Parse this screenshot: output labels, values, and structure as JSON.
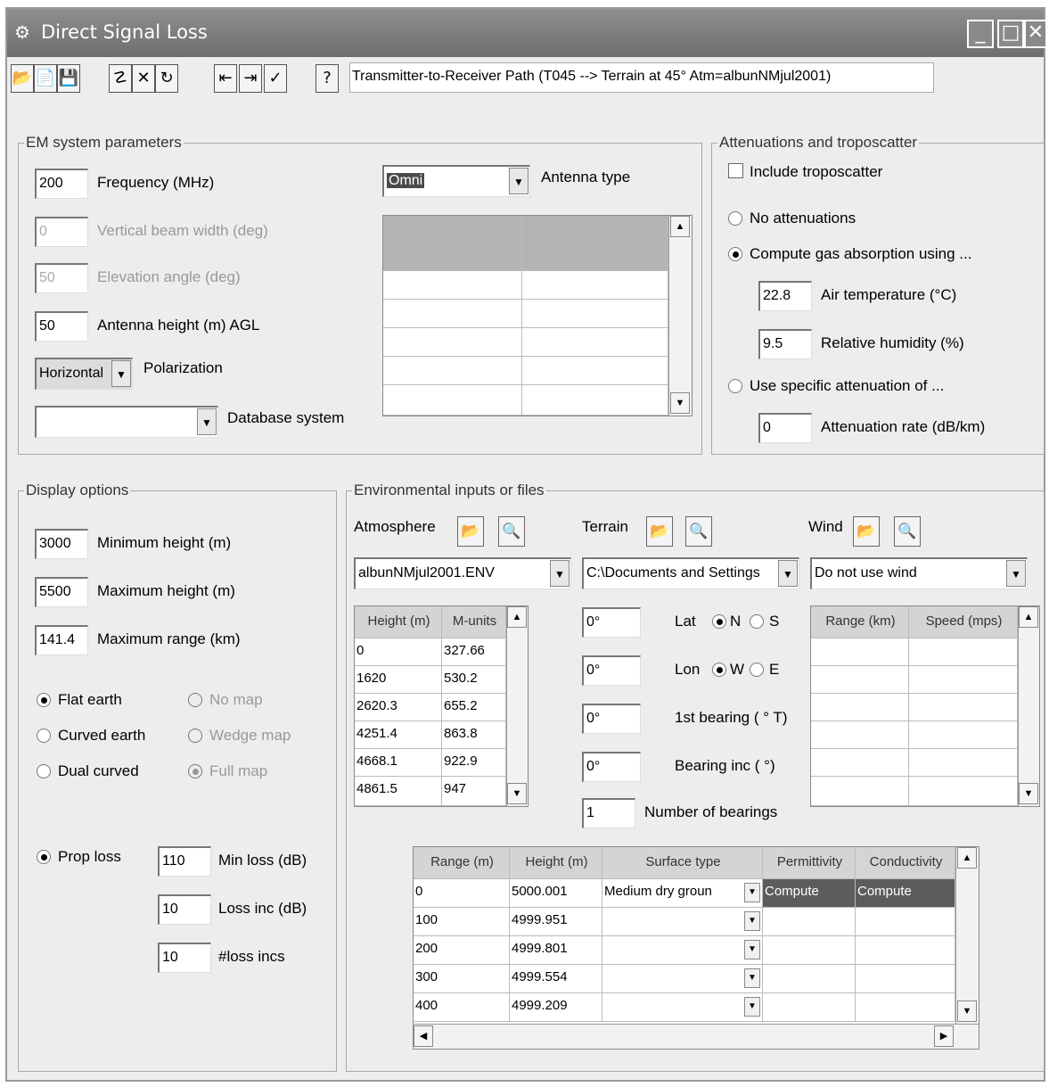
{
  "window": {
    "title": "Direct Signal Loss"
  },
  "toolbar": {
    "path": "Transmitter-to-Receiver Path (T045 --> Terrain at 45°  Atm=albunNMjul2001)"
  },
  "em": {
    "legend": "EM system parameters",
    "frequency": {
      "value": "200",
      "label": "Frequency (MHz)"
    },
    "beam": {
      "value": "0",
      "label": "Vertical beam width (deg)"
    },
    "elevation": {
      "value": "50",
      "label": "Elevation angle (deg)"
    },
    "height": {
      "value": "50",
      "label": "Antenna height (m)  AGL"
    },
    "polarization": {
      "value": "Horizontal",
      "label": "Polarization"
    },
    "database": {
      "value": "",
      "label": "Database system"
    },
    "antenna": {
      "value": "Omni",
      "label": "Antenna type"
    }
  },
  "atten": {
    "legend": "Attenuations and troposcatter",
    "tropo": "Include troposcatter",
    "none": "No attenuations",
    "gas": "Compute gas absorption using ...",
    "airtemp": {
      "value": "22.8",
      "label": "Air temperature (°C)"
    },
    "humidity": {
      "value": "9.5",
      "label": "Relative humidity (%)"
    },
    "specific": "Use specific attenuation of ...",
    "rate": {
      "value": "0",
      "label": "Attenuation rate (dB/km)"
    }
  },
  "display": {
    "legend": "Display options",
    "minh": {
      "value": "3000",
      "label": "Minimum height (m)"
    },
    "maxh": {
      "value": "5500",
      "label": "Maximum height (m)"
    },
    "maxr": {
      "value": "141.4",
      "label": "Maximum range (km)"
    },
    "flat": "Flat earth",
    "curved": "Curved earth",
    "dual": "Dual curved",
    "nomap": "No map",
    "wedge": "Wedge map",
    "full": "Full map",
    "prop": "Prop loss",
    "minloss": {
      "value": "110",
      "label": "Min loss (dB)"
    },
    "lossinc": {
      "value": "10",
      "label": "Loss inc (dB)"
    },
    "nloss": {
      "value": "10",
      "label": "#loss incs"
    }
  },
  "env": {
    "legend": "Environmental inputs or files",
    "atm_label": "Atmosphere",
    "terrain_label": "Terrain",
    "wind_label": "Wind",
    "atm_file": "albunNMjul2001.ENV",
    "terrain_file": "C:\\Documents and Settings",
    "wind_file": "Do not use wind",
    "atm_headers": [
      "Height (m)",
      "M-units"
    ],
    "atm_rows": [
      [
        "0",
        "327.66"
      ],
      [
        "1620",
        "530.2"
      ],
      [
        "2620.3",
        "655.2"
      ],
      [
        "4251.4",
        "863.8"
      ],
      [
        "4668.1",
        "922.9"
      ],
      [
        "4861.5",
        "947"
      ]
    ],
    "lat": {
      "value": "0°",
      "label": "Lat",
      "n": "N",
      "s": "S"
    },
    "lon": {
      "value": "0°",
      "label": "Lon",
      "w": "W",
      "e": "E"
    },
    "bearing1": {
      "value": "0°",
      "label": "1st bearing ( ° T)"
    },
    "bearinginc": {
      "value": "0°",
      "label": "Bearing inc ( °)"
    },
    "nbear": {
      "value": "1",
      "label": "Number of bearings"
    },
    "wind_headers": [
      "Range (km)",
      "Speed (mps)"
    ],
    "terr_headers": [
      "Range (m)",
      "Height (m)",
      "Surface type",
      "Permittivity",
      "Conductivity"
    ],
    "terr_rows": [
      [
        "0",
        "5000.001",
        "Medium dry groun",
        "Compute",
        "Compute"
      ],
      [
        "100",
        "4999.951",
        "",
        "",
        ""
      ],
      [
        "200",
        "4999.801",
        "",
        "",
        ""
      ],
      [
        "300",
        "4999.554",
        "",
        "",
        ""
      ],
      [
        "400",
        "4999.209",
        "",
        "",
        ""
      ]
    ]
  }
}
